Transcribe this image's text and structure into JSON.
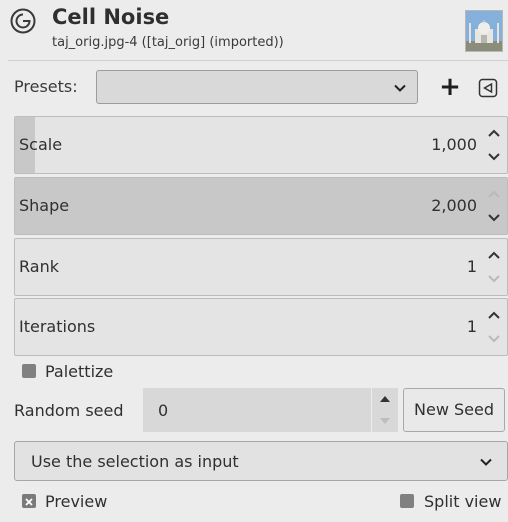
{
  "header": {
    "title": "Cell Noise",
    "subtitle": "taj_orig.jpg-4 ([taj_orig] (imported))",
    "logo_icon": "gegl-swirl-icon",
    "thumbnail": "taj-mahal-thumbnail"
  },
  "presets": {
    "label": "Presets:",
    "value": "",
    "add_label": "+",
    "menu_icon": "menu-triangle-icon"
  },
  "params": [
    {
      "label": "Scale",
      "value": "1,000",
      "fill": 0.04
    },
    {
      "label": "Shape",
      "value": "2,000",
      "fill": 1.0
    },
    {
      "label": "Rank",
      "value": "1",
      "fill": 0.0
    },
    {
      "label": "Iterations",
      "value": "1",
      "fill": 0.0
    }
  ],
  "palettize": {
    "label": "Palettize",
    "checked": false
  },
  "seed": {
    "label": "Random seed",
    "value": "0",
    "button": "New Seed"
  },
  "input_mode": {
    "value": "Use the selection as input"
  },
  "footer": {
    "preview_label": "Preview",
    "preview_checked": true,
    "split_label": "Split view",
    "split_checked": false
  },
  "colors": {
    "background": "#ececec",
    "slider_fill": "#c8c8c8",
    "border": "#bdbdbd"
  }
}
